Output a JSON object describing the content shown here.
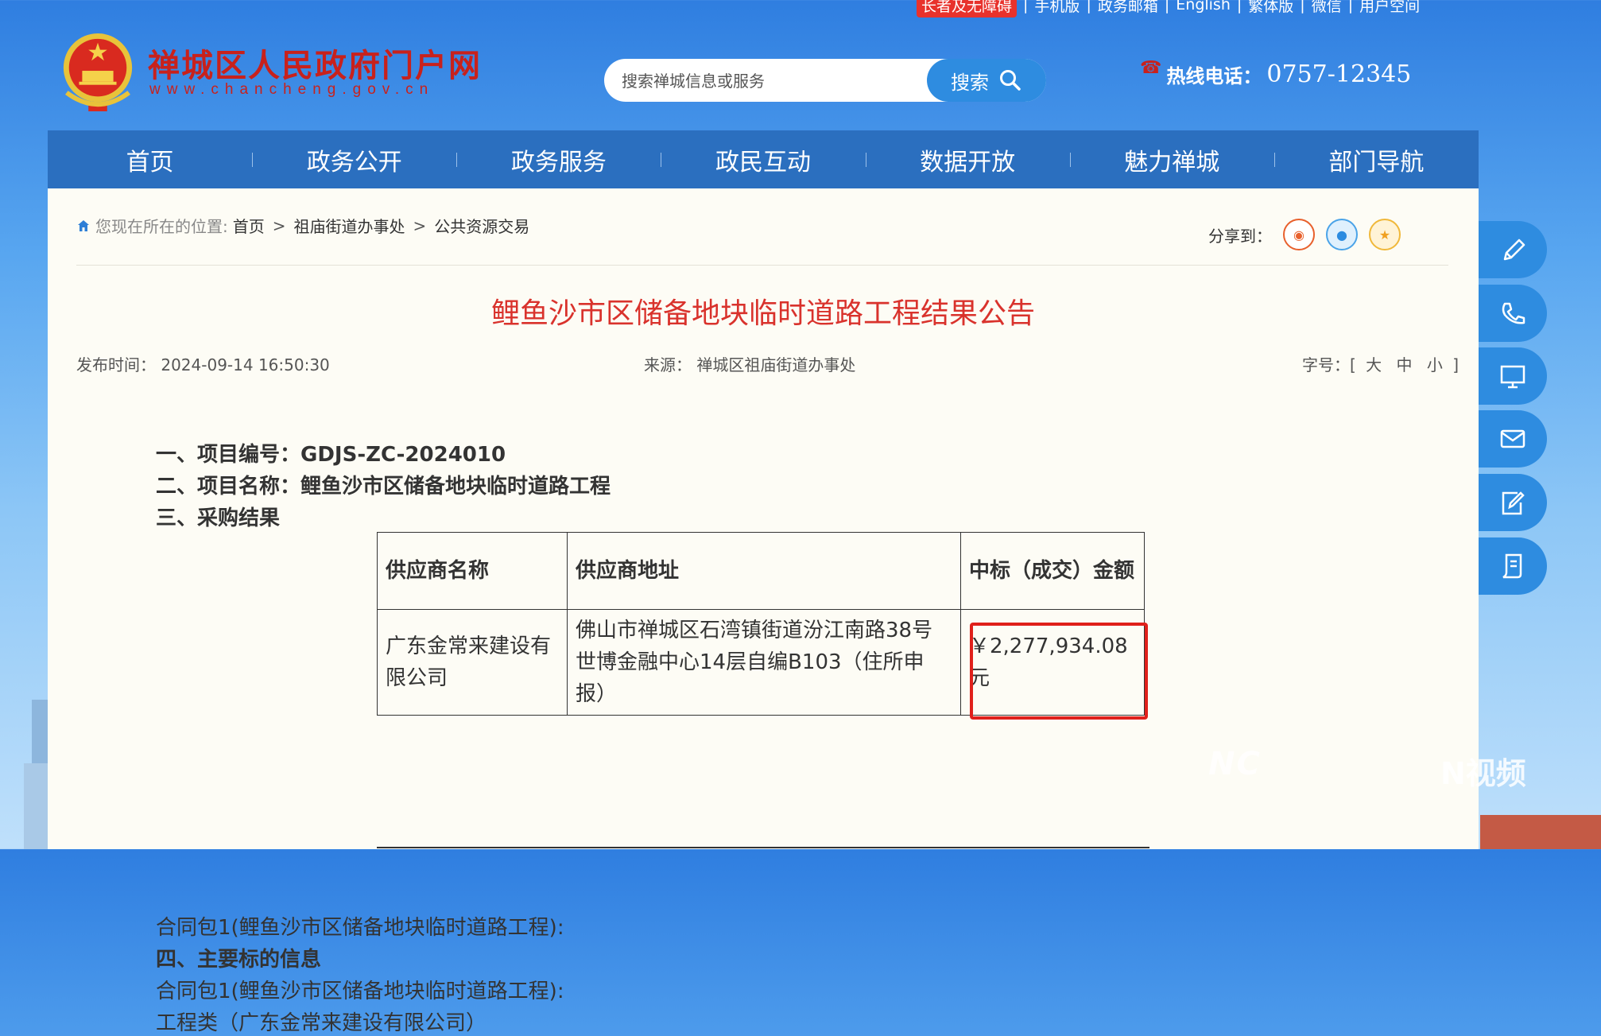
{
  "top_links": [
    "长者及无障碍",
    "手机版",
    "政务邮箱",
    "English",
    "繁体版",
    "微信",
    "用户空间"
  ],
  "header": {
    "site_title": "禅城区人民政府门户网",
    "site_url": "www.chancheng.gov.cn",
    "search_placeholder": "搜索禅城信息或服务",
    "search_button": "搜索",
    "hotline_label": "热线电话：",
    "hotline_number": "0757-12345"
  },
  "nav": [
    "首页",
    "政务公开",
    "政务服务",
    "政民互动",
    "数据开放",
    "魅力禅城",
    "部门导航"
  ],
  "breadcrumb": {
    "label": "您现在所在的位置:",
    "items": [
      "首页",
      "祖庙街道办事处",
      "公共资源交易"
    ]
  },
  "share": {
    "label": "分享到："
  },
  "article": {
    "title": "鲤鱼沙市区储备地块临时道路工程结果公告",
    "publish_label": "发布时间：",
    "publish_time": "2024-09-14 16:50:30",
    "source_label": "来源：",
    "source": "禅城区祖庙街道办事处",
    "font_size_label": "字号：[",
    "font_sizes": [
      "大",
      "中",
      "小"
    ],
    "font_size_close": "]",
    "lines": {
      "project_no": "一、项目编号：GDJS-ZC-2024010",
      "project_name": "二、项目名称：鲤鱼沙市区储备地块临时道路工程",
      "result_heading": "三、采购结果",
      "contract_pkg_1": "合同包1(鲤鱼沙市区储备地块临时道路工程):",
      "main_subject_heading": "四、主要标的信息",
      "contract_pkg_2": "合同包1(鲤鱼沙市区储备地块临时道路工程):",
      "engineering_type": "工程类（广东金常来建设有限公司）"
    },
    "table": {
      "headers": [
        "供应商名称",
        "供应商地址",
        "中标（成交）金额"
      ],
      "rows": [
        [
          "广东金常来建设有限公司",
          "佛山市禅城区石湾镇街道汾江南路38号世博金融中心14层自编B103（住所申报）",
          "￥2,277,934.08元"
        ]
      ]
    }
  },
  "side_buttons": [
    "pencil-icon",
    "phone-icon",
    "monitor-icon",
    "mail-icon",
    "edit-icon",
    "document-icon"
  ],
  "watermark": {
    "left": "NC",
    "right": "N视频"
  }
}
